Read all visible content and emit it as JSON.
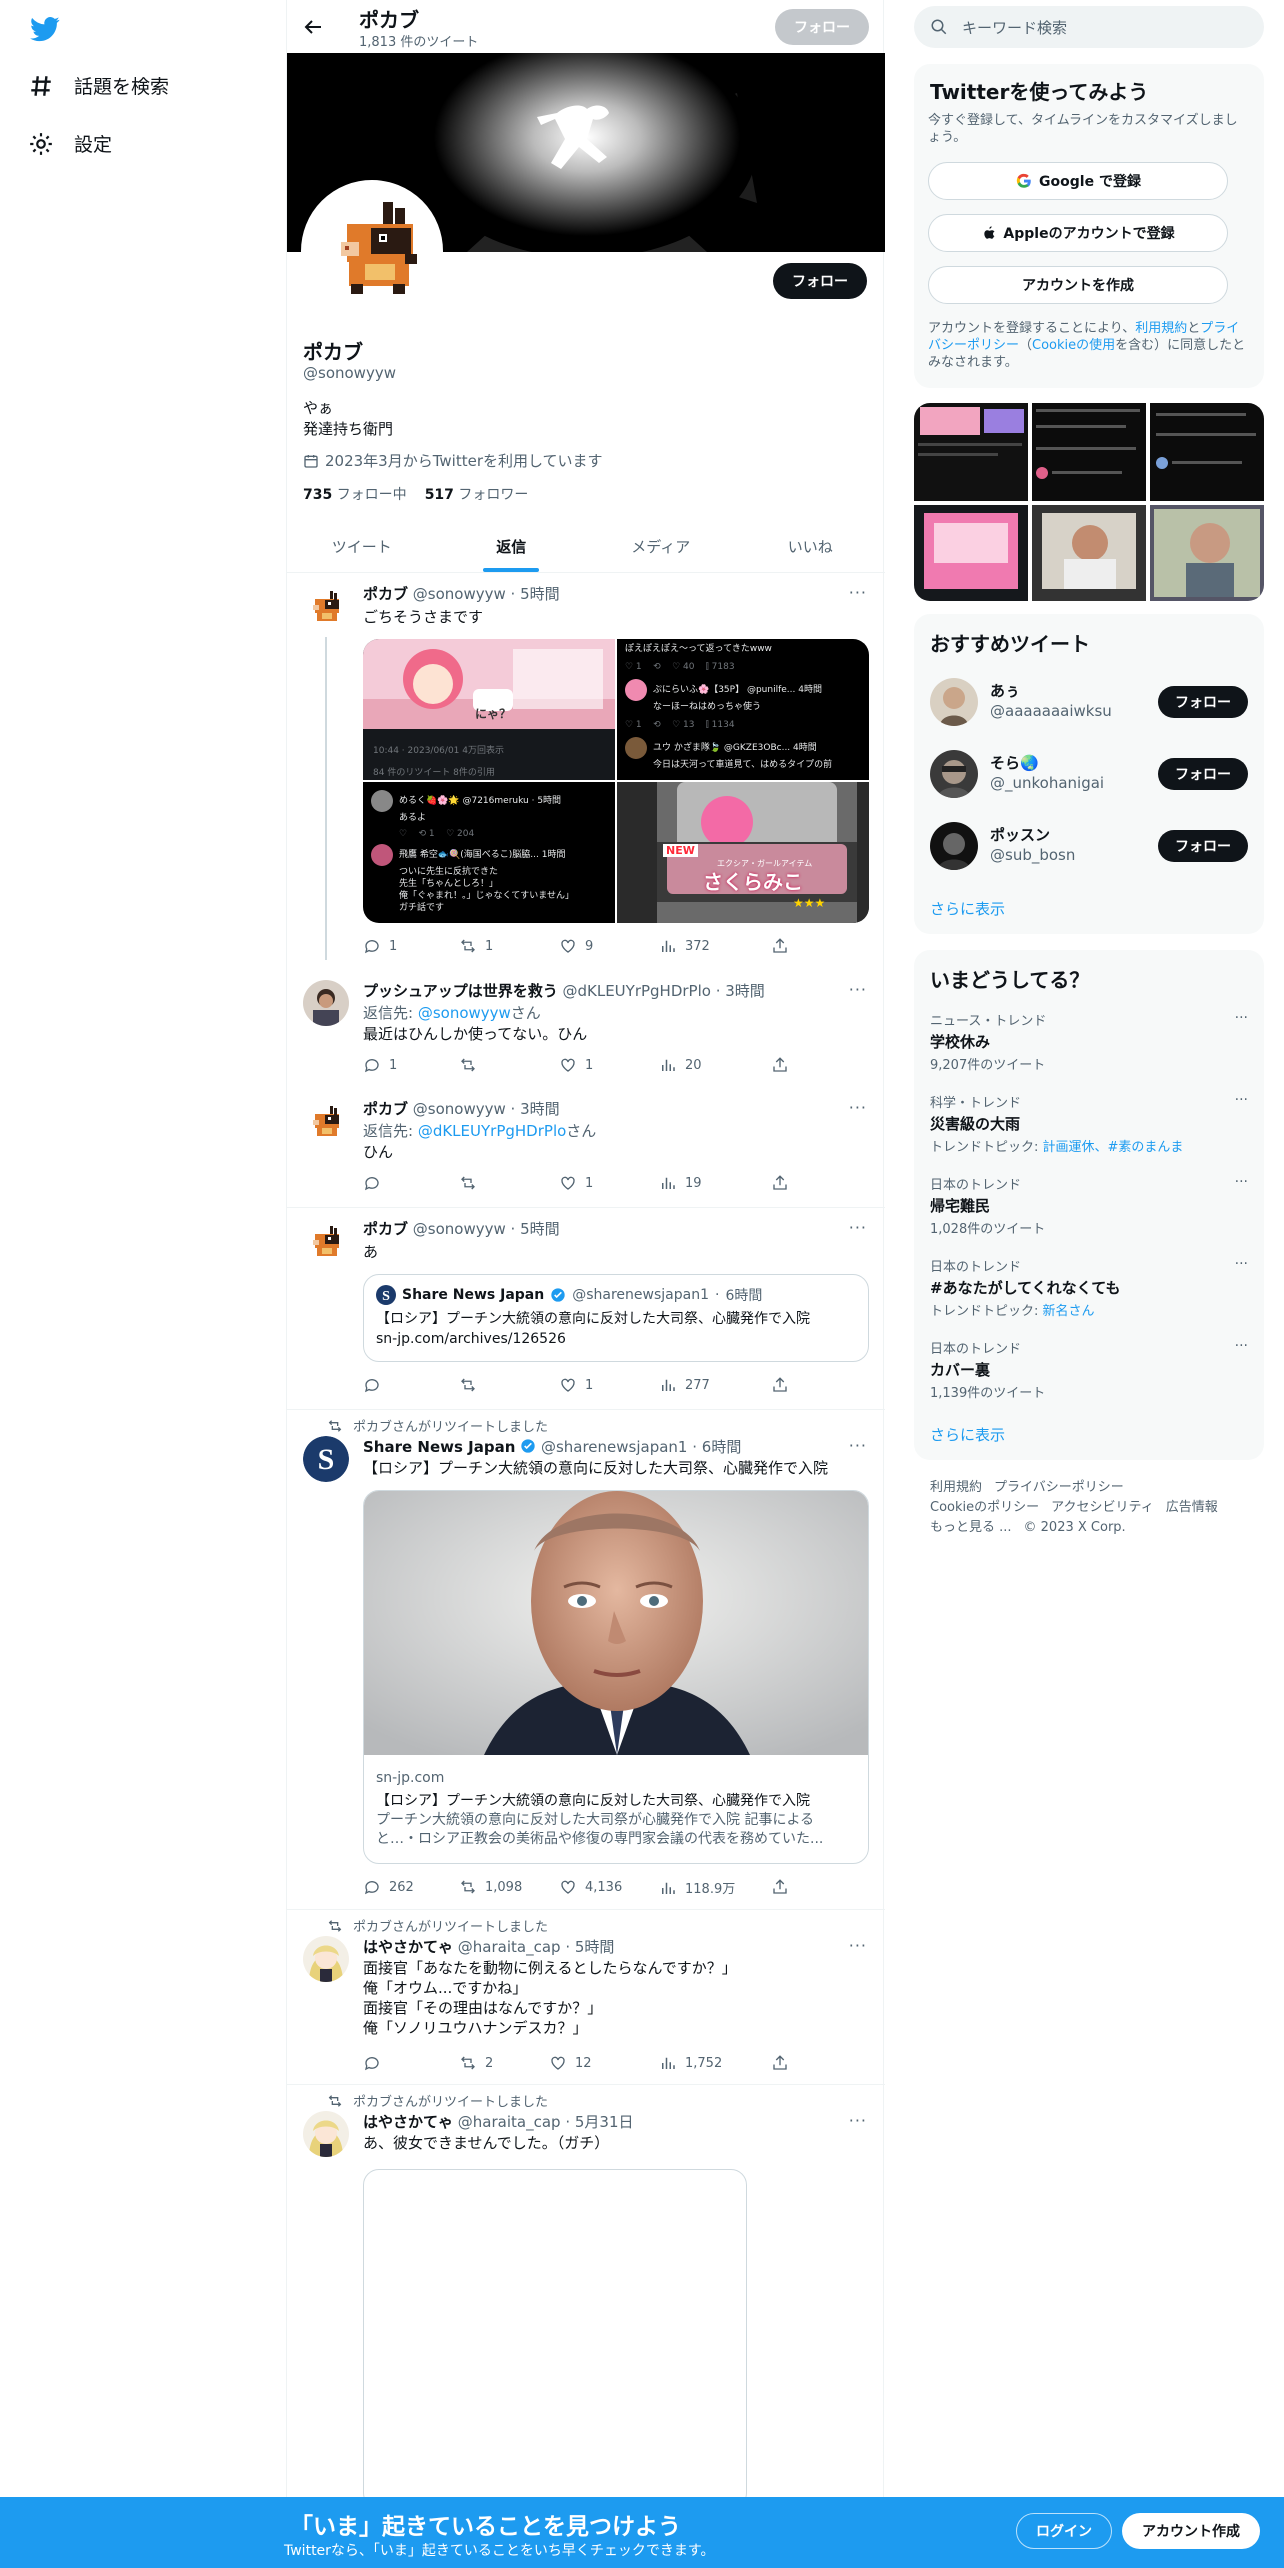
{
  "nav": {
    "explore": "話題を検索",
    "settings": "設定"
  },
  "header": {
    "name": "ポカブ",
    "tweet_count": "1,813 件のツイート",
    "follow_label": "フォロー"
  },
  "profile": {
    "name": "ポカブ",
    "handle": "@sonowyyw",
    "bio": "やぁ\n発達持ち衛門",
    "joined": "2023年3月からTwitterを利用しています",
    "following_count": "735",
    "following_label": "フォロー中",
    "followers_count": "517",
    "followers_label": "フォロワー",
    "follow_label": "フォロー"
  },
  "tabs": [
    {
      "label": "ツイート"
    },
    {
      "label": "返信"
    },
    {
      "label": "メディア"
    },
    {
      "label": "いいね"
    }
  ],
  "tweets": [
    {
      "name": "ポカブ",
      "handle": "@sonowyyw",
      "time": "5時間",
      "text": "ごちそうさまです",
      "reply": "",
      "like": "9",
      "retweet": "1",
      "replies": "1",
      "views": "372",
      "media": {
        "t1_label": "にゃ？",
        "t1_meta": "10:44 · 2023/06/01  4万回表示",
        "t1_stats": "84 件のリツイート  8件の引用",
        "t2_lines": [
          "ぽえぽえぽえ〜って返ってきたwww",
          "ぷにらいふ🌸【35P】 @punilfe... 4時間",
          "なーほーねはめっちゃ使う",
          "今日は天河って車道見て、はめるタイプの前"
        ],
        "t2_user2": "ユウ かざま隊🍃 @GKZE3OBc... 4時間",
        "t3_lines": [
          "めるく🍓🌸🌟 @7216meruku · 5時間",
          "あるよ",
          "飛鷹 希空🐟🍭(海国べるこ)脳脇... 1時間",
          "ついに先生に反抗できた",
          "先生「ちゃんとしろ！」",
          "俺「ぐゃまれ！。」じゃなくてすいません」",
          "ガチ話です"
        ],
        "t4_new": "NEW",
        "t4_sub": "エクシア・ガールアイテム",
        "t4_title": "さくらみこ",
        "t4_stars": "★★★"
      }
    },
    {
      "name": "プッシュアップは世界を救う",
      "handle": "@dKLEUYrPgHDrPlo",
      "time": "3時間",
      "reply_prefix": "返信先: ",
      "reply_to": "@sonowyyw",
      "reply_suffix": "さん",
      "text": "最近はひんしか使ってない。ひん",
      "replies": "1",
      "retweet": "",
      "like": "1",
      "views": "20"
    },
    {
      "name": "ポカブ",
      "handle": "@sonowyyw",
      "time": "3時間",
      "reply_prefix": "返信先: ",
      "reply_to": "@dKLEUYrPgHDrPlo",
      "reply_suffix": "さん",
      "text": "ひん",
      "replies": "",
      "retweet": "",
      "like": "1",
      "views": "19"
    },
    {
      "name": "ポカブ",
      "handle": "@sonowyyw",
      "time": "5時間",
      "text": "あ",
      "replies": "",
      "retweet": "",
      "like": "1",
      "views": "277",
      "quote": {
        "name": "Share News Japan",
        "handle": "@sharenewsjapan1",
        "time": "6時間",
        "text": "【ロシア】プーチン大統領の意向に反対した大司祭、心臓発作で入院\nsn-jp.com/archives/126526"
      }
    },
    {
      "rt_label": "ポカブさんがリツイートしました",
      "name": "Share News Japan",
      "handle": "@sharenewsjapan1",
      "time": "6時間",
      "text": "【ロシア】プーチン大統領の意向に反対した大司祭、心臓発作で入院",
      "card": {
        "domain": "sn-jp.com",
        "title": "【ロシア】プーチン大統領の意向に反対した大司祭、心臓発作で入院",
        "desc": "プーチン大統領の意向に反対した大司祭が心臓発作で入院 記事によると…・ロシア正教会の美術品や修復の専門家会議の代表を務めていた..."
      },
      "replies": "262",
      "retweet": "1,098",
      "like": "4,136",
      "views": "118.9万"
    },
    {
      "rt_label": "ポカブさんがリツイートしました",
      "name": "はやさかてゃ",
      "handle": "@haraita_cap",
      "time": "5時間",
      "text": "面接官「あなたを動物に例えるとしたらなんですか？」\n俺「オウム...ですかね」\n面接官「その理由はなんですか？」\n俺「ソノリユウハナンデスカ？」",
      "replies": "",
      "retweet": "2",
      "like": "12",
      "views": "1,752"
    },
    {
      "rt_label": "ポカブさんがリツイートしました",
      "name": "はやさかてゃ",
      "handle": "@haraita_cap",
      "time": "5月31日",
      "text": "あ、彼女できませんでした。（ガチ）"
    }
  ],
  "right": {
    "search_placeholder": "キーワード検索",
    "signup": {
      "title": "Twitterを使ってみよう",
      "subtitle": "今すぐ登録して、タイムラインをカスタマイズしましょう。",
      "google": "Google で登録",
      "apple": "Appleのアカウントで登録",
      "create": "アカウントを作成",
      "legal_1": "アカウントを登録することにより、",
      "legal_terms": "利用規約",
      "legal_2": "と",
      "legal_privacy": "プライバシーポリシー",
      "legal_3": "（",
      "legal_cookie": "Cookieの使用",
      "legal_4": "を含む）に同意したとみなされます。"
    },
    "recommended": {
      "title": "おすすめツイート",
      "users": [
        {
          "name": "あぅ",
          "handle": "@aaaaaaaiwksu"
        },
        {
          "name": "そら🌏",
          "handle": "@_unkohanigai"
        },
        {
          "name": "ポッスン",
          "handle": "@sub_bosn"
        }
      ],
      "follow": "フォロー",
      "more": "さらに表示"
    },
    "trends": {
      "title": "いまどうしてる？",
      "items": [
        {
          "cat": "ニュース・トレンド",
          "title": "学校休み",
          "meta": "9,207件のツイート"
        },
        {
          "cat": "科学・トレンド",
          "title": "災害級の大雨",
          "meta_prefix": "トレンドトピック: ",
          "meta_link": "計画運休、#素のまんま"
        },
        {
          "cat": "日本のトレンド",
          "title": "帰宅難民",
          "meta": "1,028件のツイート"
        },
        {
          "cat": "日本のトレンド",
          "title": "#あなたがしてくれなくても",
          "meta_prefix": "トレンドトピック: ",
          "meta_link": "新名さん"
        },
        {
          "cat": "日本のトレンド",
          "title": "カバー裏",
          "meta": "1,139件のツイート"
        }
      ],
      "more": "さらに表示"
    },
    "footer": {
      "terms": "利用規約",
      "privacy": "プライバシーポリシー",
      "cookie": "Cookieのポリシー",
      "accessibility": "アクセシビリティ",
      "ads": "広告情報",
      "more": "もっと見る ...",
      "copyright": "© 2023 X Corp."
    }
  },
  "bottom": {
    "title": "「いま」起きていることを見つけよう",
    "subtitle": "Twitterなら、「いま」起きていることをいち早くチェックできます。",
    "login": "ログイン",
    "signup": "アカウント作成"
  },
  "colors": {
    "accent": "#1d9bf0",
    "text": "#0f1419",
    "muted": "#536471"
  }
}
